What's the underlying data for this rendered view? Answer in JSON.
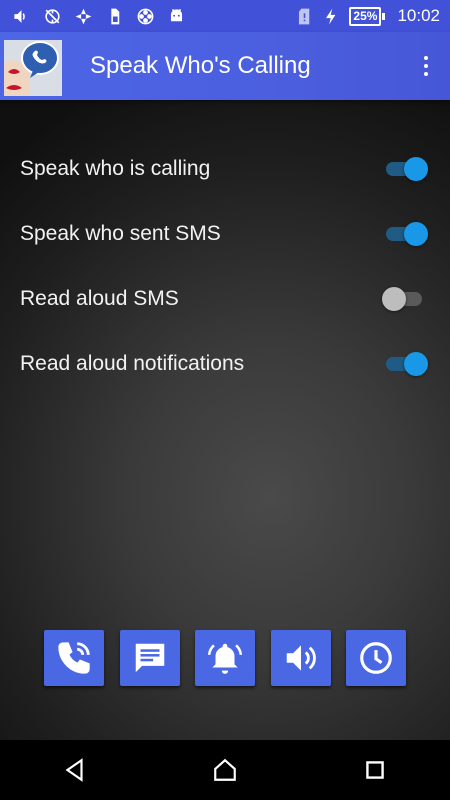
{
  "status_bar": {
    "left_icons": [
      "volume-icon",
      "sync-off-icon",
      "vpn-icon",
      "sim-icon",
      "film-reel-icon",
      "android-icon"
    ],
    "sd_alert_icon": "sd-card-alert-icon",
    "battery_percent": "25%",
    "time": "10:02"
  },
  "app_bar": {
    "title": "Speak Who's Calling",
    "menu_icon": "more-vert-icon"
  },
  "settings": [
    {
      "label": "Speak who is calling",
      "enabled": true
    },
    {
      "label": "Speak who sent SMS",
      "enabled": true
    },
    {
      "label": "Read aloud SMS",
      "enabled": false
    },
    {
      "label": "Read aloud notifications",
      "enabled": true
    }
  ],
  "actions": [
    {
      "name": "calls-button",
      "icon": "phone-ring-icon"
    },
    {
      "name": "sms-button",
      "icon": "message-icon"
    },
    {
      "name": "notifications-button",
      "icon": "bell-ring-icon"
    },
    {
      "name": "volume-button",
      "icon": "speaker-icon"
    },
    {
      "name": "schedule-button",
      "icon": "clock-icon"
    }
  ],
  "colors": {
    "primary": "#4b5fdf",
    "switch_on": "#1a98e8",
    "button": "#4a68e4"
  }
}
